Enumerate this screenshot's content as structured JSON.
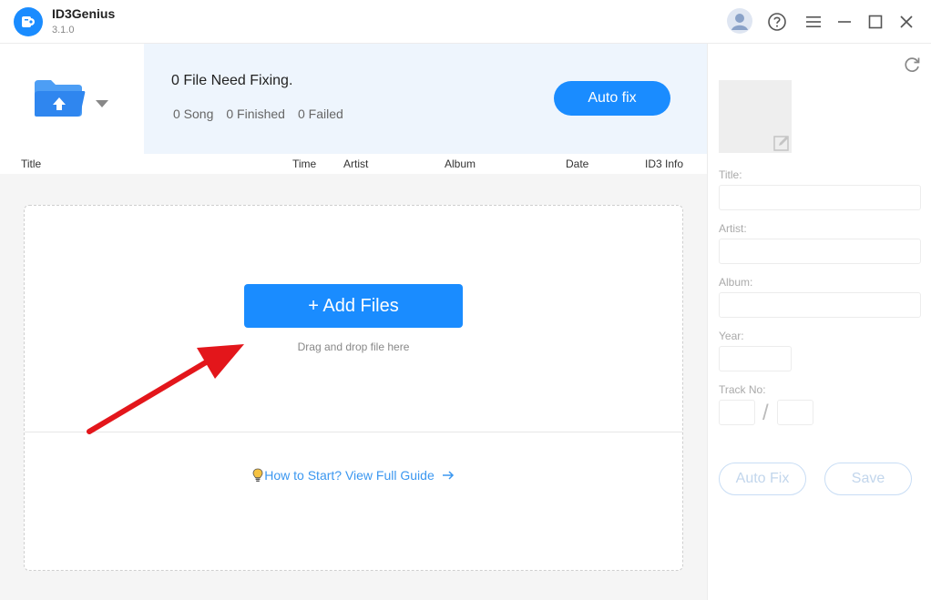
{
  "app": {
    "name": "ID3Genius",
    "version": "3.1.0"
  },
  "summary": {
    "need_fixing": "0 File Need Fixing.",
    "song_count": "0 Song",
    "finished_count": "0 Finished",
    "failed_count": "0 Failed",
    "autofix_label": "Auto fix"
  },
  "table": {
    "columns": [
      "Title",
      "Time",
      "Artist",
      "Album",
      "Date",
      "ID3 Info"
    ]
  },
  "dropzone": {
    "add_files_label": "+ Add Files",
    "drag_hint": "Drag and drop file here",
    "guide_label": "How to Start? View Full Guide"
  },
  "editor": {
    "title_label": "Title:",
    "artist_label": "Artist:",
    "album_label": "Album:",
    "year_label": "Year:",
    "track_label": "Track No:",
    "track_separator": "/",
    "autofix_label": "Auto Fix",
    "save_label": "Save"
  },
  "colors": {
    "accent": "#1a8cff",
    "status_bg": "#eef5fd",
    "annotation_arrow": "#e3161b"
  }
}
